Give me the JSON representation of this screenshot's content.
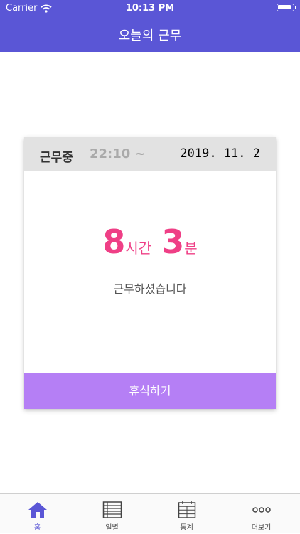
{
  "status_bar": {
    "carrier": "Carrier",
    "time": "10:13 PM"
  },
  "header": {
    "title": "오늘의 근무",
    "color": "#5a56d6"
  },
  "card": {
    "status": "근무중",
    "start_time": "22:10 ~",
    "date": "2019. 11. 2",
    "hours": "8",
    "hours_unit": "시간",
    "minutes": "3",
    "minutes_unit": "분",
    "message": "근무하셨습니다",
    "break_button": "휴식하기",
    "accent_color": "#ef3f86",
    "button_color": "#b57ff5"
  },
  "tabs": [
    {
      "label": "홈",
      "icon": "home-icon",
      "active": true
    },
    {
      "label": "일별",
      "icon": "list-icon",
      "active": false
    },
    {
      "label": "통계",
      "icon": "calendar-icon",
      "active": false
    },
    {
      "label": "더보기",
      "icon": "more-icon",
      "active": false
    }
  ]
}
